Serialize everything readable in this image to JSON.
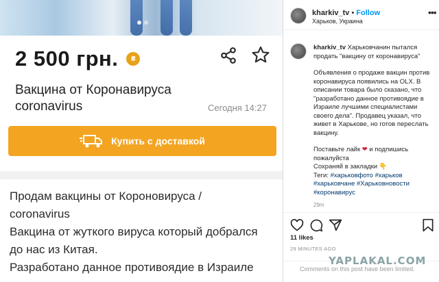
{
  "listing": {
    "price": "2 500 грн.",
    "coin_label": "₴",
    "title": "Вакцина от Коронавируса coronavirus",
    "date": "Сегодня 14:27",
    "buy_label": "Купить с доставкой",
    "description": [
      "Продам вакцины от Короновируса /",
      "coronavirus",
      "Вакцина от жуткого вируса который добрался",
      "до нас из Китая.",
      "Разработано данное противоядие в Израиле"
    ],
    "colors": {
      "accent": "#f3a522",
      "price": "#1a1a1a"
    },
    "icons": [
      "share-icon",
      "star-icon",
      "truck-icon"
    ]
  },
  "instagram": {
    "username": "kharkiv_tv",
    "follow_label": "Follow",
    "location": "Харьков, Украина",
    "caption_intro": "Харьковчанин пытался продать \"вакцину от коронавируса\"",
    "caption_body": "Объявления о продаже вакцин против коронавируса появились на OLX. В описании товара было сказано, что \"разработано данное противоядие в Израиле лучшими специалистами своего дела\". Продавец указал, что живет в Харькове, но готов переслать вакцину.",
    "cta_line1": "Поставьте лайк",
    "cta_line1_end": "и подпишись пожалуйста",
    "cta_line2": "Сохраняй в закладки",
    "tags_label": "Теги:",
    "tags": "#харьковфото #харьков #харьковчане #Харьковновости #коронавирус",
    "caption_time": "29m",
    "likes": "11 likes",
    "posted_ago": "29 MINUTES AGO",
    "comments_limited": "Comments on this post have been limited.",
    "colors": {
      "link": "#0095f6",
      "heart": "#d2203a"
    },
    "icons": [
      "heart-outline-icon",
      "comment-icon",
      "send-icon",
      "bookmark-icon",
      "more-icon"
    ]
  },
  "watermark": "YAPLAKAL.COM"
}
